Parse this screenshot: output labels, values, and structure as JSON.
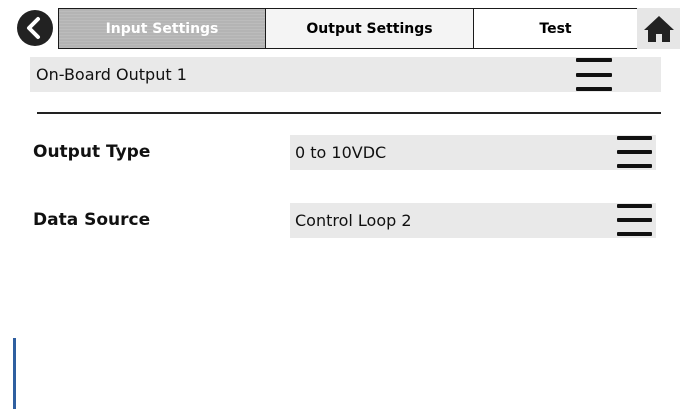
{
  "tabs": {
    "input": "Input Settings",
    "output": "Output Settings",
    "test": "Test"
  },
  "icons": {
    "back": "chevron-left-circle-icon",
    "home": "home-icon",
    "menu": "hamburger-menu-icon"
  },
  "output_selector": {
    "value": "On-Board Output 1"
  },
  "fields": [
    {
      "label": "Output Type",
      "value": "0 to 10VDC"
    },
    {
      "label": "Data Source",
      "value": "Control Loop 2"
    }
  ],
  "colors": {
    "disabled_tab": "#b4b4b4",
    "field_background": "#e9e9e9",
    "icon": "#111111"
  }
}
